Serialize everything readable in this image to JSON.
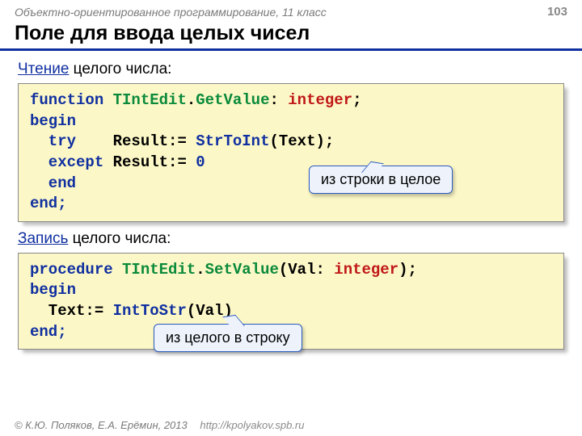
{
  "header": {
    "course": "Объектно-ориентированное программирование, 11 класс",
    "page": "103"
  },
  "title": "Поле для ввода целых чисел",
  "read": {
    "label_blue": "Чтение",
    "label_rest": " целого числа:",
    "code": {
      "l1a": "function ",
      "l1b": "TIntEdit",
      "l1c": ".",
      "l1d": "GetValue",
      "l1e": ": ",
      "l1f": "integer",
      "l1g": ";",
      "l2": "begin",
      "l3a": "  try    ",
      "l3b": "Result:= ",
      "l3c": "StrToInt",
      "l3d": "(Text);",
      "l4a": "  except ",
      "l4b": "Result:= ",
      "l4c": "0",
      "l5": "  end",
      "l6": "end;"
    },
    "callout": "из строки в целое"
  },
  "write": {
    "label_blue": "Запись",
    "label_rest": " целого числа:",
    "code": {
      "l1a": "procedure ",
      "l1b": "TIntEdit",
      "l1c": ".",
      "l1d": "SetValue",
      "l1e": "(Val: ",
      "l1f": "integer",
      "l1g": ");",
      "l2": "begin",
      "l3a": "  Text:= ",
      "l3b": "IntToStr",
      "l3c": "(Val)",
      "l4": "end;"
    },
    "callout": "из целого в строку"
  },
  "footer": {
    "copyright": "© К.Ю. Поляков, Е.А. Ерёмин, 2013",
    "url": "http://kpolyakov.spb.ru"
  }
}
